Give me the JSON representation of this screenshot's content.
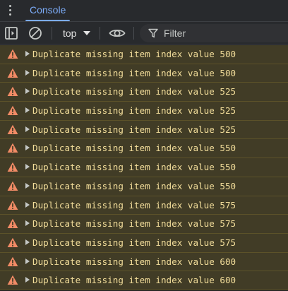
{
  "tabs": {
    "active": "Console"
  },
  "toolbar": {
    "context_value": "top",
    "filter_placeholder": "Filter"
  },
  "colors": {
    "accent": "#7cacf8",
    "warning_background": "#413c26",
    "warning_text": "#f2dd9a",
    "warning_icon": "#f28b66"
  },
  "messages": [
    {
      "level": "warning",
      "icon": "warning-triangle-icon",
      "text": "Duplicate missing item index value 500"
    },
    {
      "level": "warning",
      "icon": "warning-triangle-icon",
      "text": "Duplicate missing item index value 500"
    },
    {
      "level": "warning",
      "icon": "warning-triangle-icon",
      "text": "Duplicate missing item index value 525"
    },
    {
      "level": "warning",
      "icon": "warning-triangle-icon",
      "text": "Duplicate missing item index value 525"
    },
    {
      "level": "warning",
      "icon": "warning-triangle-icon",
      "text": "Duplicate missing item index value 525"
    },
    {
      "level": "warning",
      "icon": "warning-triangle-icon",
      "text": "Duplicate missing item index value 550"
    },
    {
      "level": "warning",
      "icon": "warning-triangle-icon",
      "text": "Duplicate missing item index value 550"
    },
    {
      "level": "warning",
      "icon": "warning-triangle-icon",
      "text": "Duplicate missing item index value 550"
    },
    {
      "level": "warning",
      "icon": "warning-triangle-icon",
      "text": "Duplicate missing item index value 575"
    },
    {
      "level": "warning",
      "icon": "warning-triangle-icon",
      "text": "Duplicate missing item index value 575"
    },
    {
      "level": "warning",
      "icon": "warning-triangle-icon",
      "text": "Duplicate missing item index value 575"
    },
    {
      "level": "warning",
      "icon": "warning-triangle-icon",
      "text": "Duplicate missing item index value 600"
    },
    {
      "level": "warning",
      "icon": "warning-triangle-icon",
      "text": "Duplicate missing item index value 600"
    }
  ]
}
